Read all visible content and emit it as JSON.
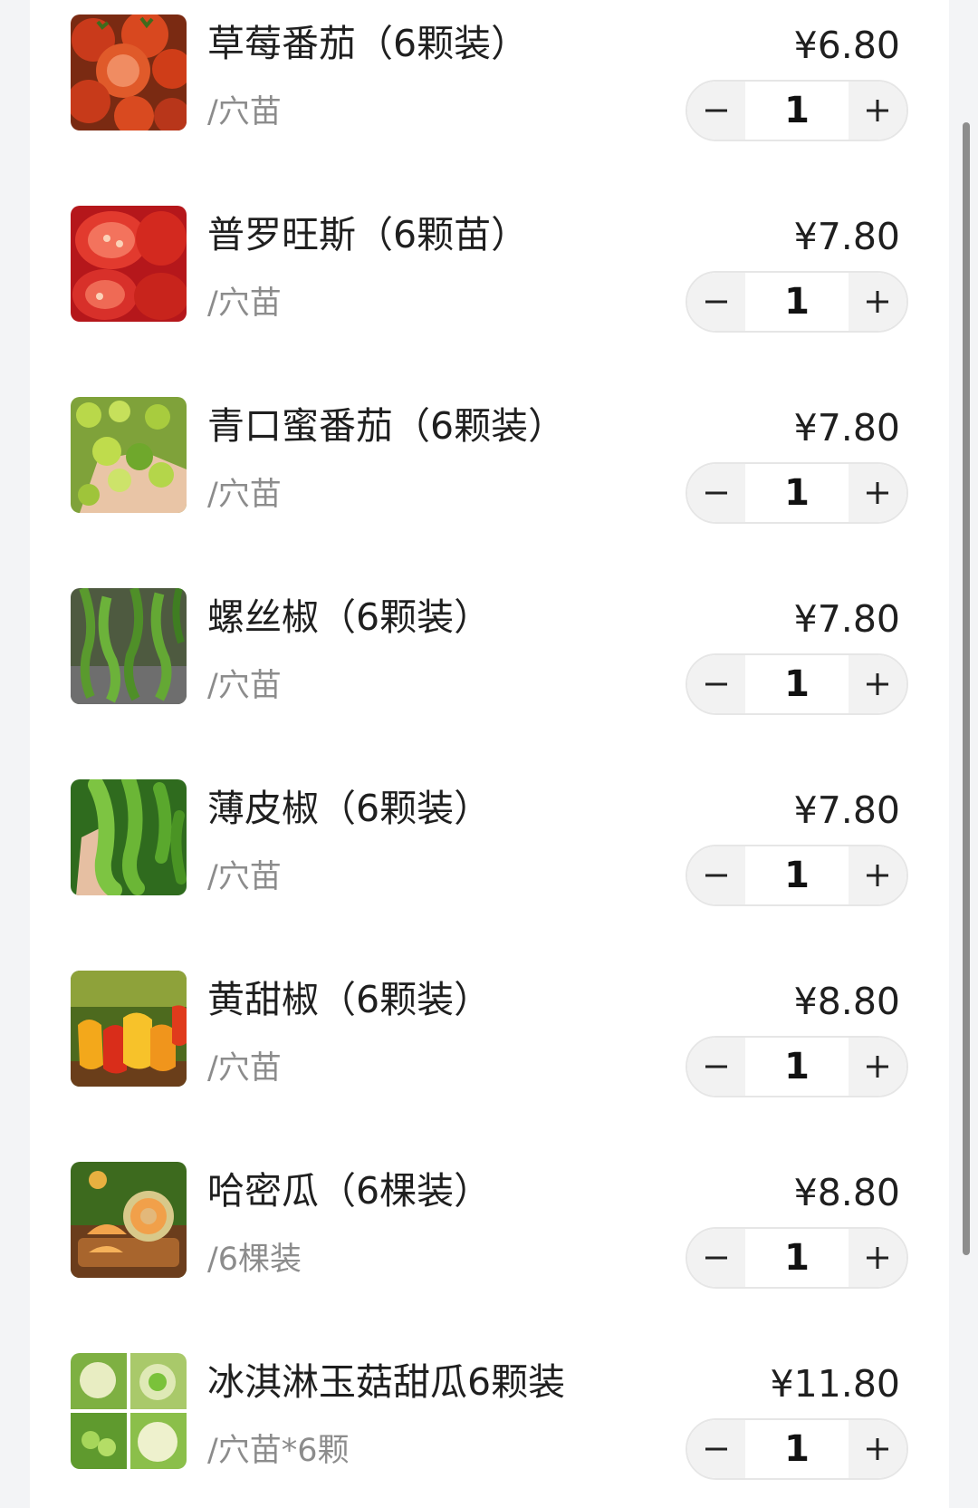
{
  "items": [
    {
      "name": "草莓番茄（6颗装）",
      "unit": "/穴苗",
      "price": "¥6.80",
      "qty": "1",
      "image": "tomato-photo"
    },
    {
      "name": "普罗旺斯（6颗苗）",
      "unit": "/穴苗",
      "price": "¥7.80",
      "qty": "1",
      "image": "sliced-tomato-photo"
    },
    {
      "name": "青口蜜番茄（6颗装）",
      "unit": "/穴苗",
      "price": "¥7.80",
      "qty": "1",
      "image": "green-tomato-photo"
    },
    {
      "name": "螺丝椒（6颗装）",
      "unit": "/穴苗",
      "price": "¥7.80",
      "qty": "1",
      "image": "twisted-pepper-photo"
    },
    {
      "name": "薄皮椒（6颗装）",
      "unit": "/穴苗",
      "price": "¥7.80",
      "qty": "1",
      "image": "thin-pepper-photo"
    },
    {
      "name": "黄甜椒（6颗装）",
      "unit": "/穴苗",
      "price": "¥8.80",
      "qty": "1",
      "image": "yellow-pepper-photo"
    },
    {
      "name": "哈密瓜（6棵装）",
      "unit": "/6棵装",
      "price": "¥8.80",
      "qty": "1",
      "image": "melon-photo"
    },
    {
      "name": "冰淇淋玉菇甜瓜6颗装",
      "unit": "/穴苗*6颗",
      "price": "¥11.80",
      "qty": "1",
      "image": "sweet-melon-photo"
    }
  ],
  "icons": {
    "minus": "minus-icon",
    "plus": "plus-icon"
  },
  "colors": {
    "text": "#1f1f1f",
    "muted": "#8c8c8c",
    "stepper_bg": "#f2f2f2"
  }
}
